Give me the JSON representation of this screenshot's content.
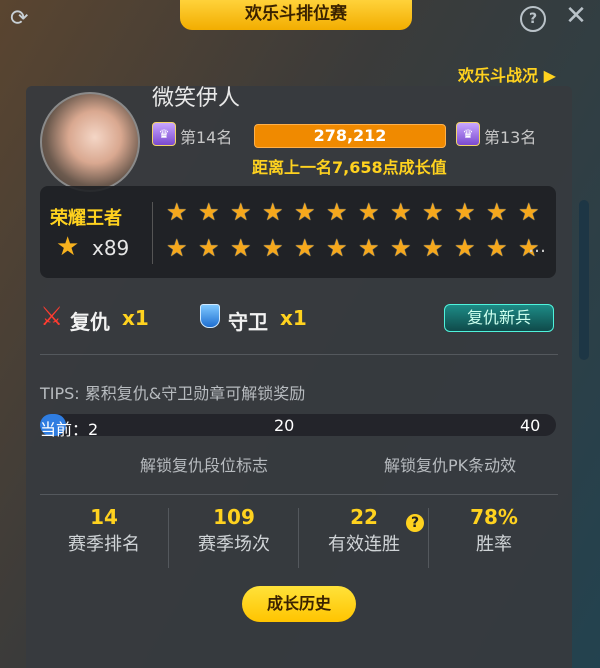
{
  "window": {
    "title": "欢乐斗排位赛",
    "battle_status_link": "欢乐斗战况 ▶"
  },
  "profile": {
    "username": "微笑伊人",
    "current_rank": "第14名",
    "next_rank": "第13名",
    "points": "278,212",
    "gap_text": "距离上一名7,658点成长值"
  },
  "king": {
    "title": "荣耀王者",
    "count": "x89",
    "stars_shown": 24,
    "more": "…"
  },
  "badges": {
    "revenge_label": "复仇",
    "revenge_count": "x1",
    "guard_label": "守卫",
    "guard_count": "x1",
    "new_revenge_button": "复仇新兵"
  },
  "tips": {
    "text": "TIPS: 累积复仇&守卫勋章可解锁奖励",
    "current_label": "当前：2",
    "mid_label": "20",
    "end_label": "40",
    "current_value": 2,
    "max_value": 40,
    "unlock_1": "解锁复仇段位标志",
    "unlock_2": "解锁复仇PK条动效"
  },
  "stats": [
    {
      "value": "14",
      "label": "赛季排名"
    },
    {
      "value": "109",
      "label": "赛季场次"
    },
    {
      "value": "22",
      "label": "有效连胜"
    },
    {
      "value": "78%",
      "label": "胜率"
    }
  ],
  "history_button": "成长历史",
  "icons": {
    "refresh": "refresh-icon",
    "help": "help-icon",
    "close": "close-icon",
    "rank_badge": "rank-badge-icon",
    "star": "star-icon",
    "revenge": "revenge-icon",
    "shield": "shield-icon",
    "question": "question-icon"
  },
  "colors": {
    "accent": "#ffd21f",
    "progress": "#f08a00",
    "track_fill": "#2f7de1"
  }
}
